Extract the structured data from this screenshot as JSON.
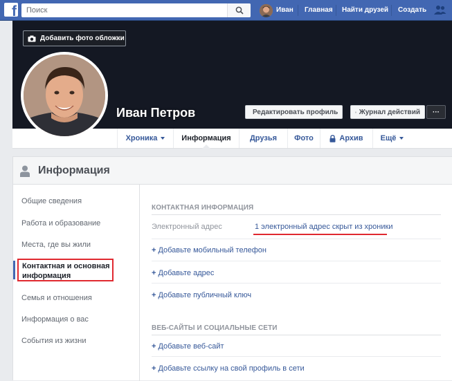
{
  "topbar": {
    "logo": "f",
    "search_placeholder": "Поиск",
    "user_name": "Иван",
    "home_label": "Главная",
    "find_friends_label": "Найти друзей",
    "create_label": "Создать"
  },
  "profile": {
    "add_cover_label": "Добавить фото обложки",
    "name": "Иван Петров",
    "edit_profile_label": "Редактировать профиль",
    "activity_log_label": "Журнал действий",
    "more_label": "···"
  },
  "tabs": [
    {
      "label": "Хроника"
    },
    {
      "label": "Информация"
    },
    {
      "label": "Друзья"
    },
    {
      "label": "Фото"
    },
    {
      "label": "Архив"
    },
    {
      "label": "Ещё"
    }
  ],
  "info": {
    "title": "Информация",
    "menu": [
      "Общие сведения",
      "Работа и образование",
      "Места, где вы жили",
      "Контактная и основная информация",
      "Семья и отношения",
      "Информация о вас",
      "События из жизни"
    ],
    "contact_section_title": "КОНТАКТНАЯ ИНФОРМАЦИЯ",
    "email_label": "Электронный адрес",
    "email_value": "1 электронный адрес скрыт из хроники",
    "add_phone": "Добавьте мобильный телефон",
    "add_address": "Добавьте адрес",
    "add_key": "Добавьте публичный ключ",
    "web_section_title": "ВЕБ-САЙТЫ И СОЦИАЛЬНЫЕ СЕТИ",
    "add_website": "Добавьте веб-сайт",
    "add_social": "Добавьте ссылку на свой профиль в сети"
  },
  "colors": {
    "brand": "#4267b2",
    "link": "#365899",
    "highlight": "#e0282f"
  }
}
